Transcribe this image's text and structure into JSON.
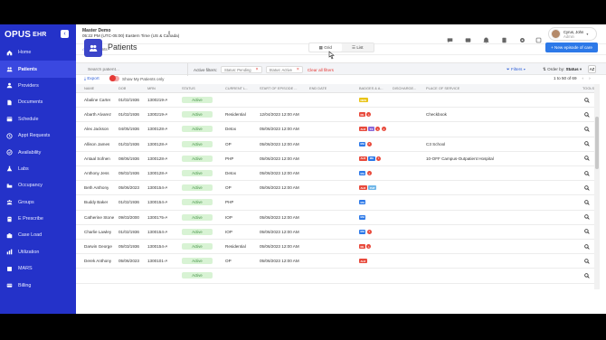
{
  "app": {
    "brand": "OPUS",
    "brand_suffix": "EHR"
  },
  "sidebar": {
    "items": [
      {
        "label": "Home",
        "icon": "home-icon"
      },
      {
        "label": "Patients",
        "icon": "patients-icon",
        "active": true
      },
      {
        "label": "Providers",
        "icon": "providers-icon"
      },
      {
        "label": "Documents",
        "icon": "documents-icon"
      },
      {
        "label": "Schedule",
        "icon": "schedule-icon"
      },
      {
        "label": "Appt Requests",
        "icon": "appt-requests-icon"
      },
      {
        "label": "Availability",
        "icon": "availability-icon"
      },
      {
        "label": "Labs",
        "icon": "labs-icon"
      },
      {
        "label": "Occupancy",
        "icon": "occupancy-icon"
      },
      {
        "label": "Groups",
        "icon": "groups-icon"
      },
      {
        "label": "E Prescribe",
        "icon": "eprescribe-icon"
      },
      {
        "label": "Case Load",
        "icon": "caseload-icon"
      },
      {
        "label": "Utilization",
        "icon": "utilization-icon"
      },
      {
        "label": "MARS",
        "icon": "mars-icon"
      },
      {
        "label": "Billing",
        "icon": "billing-icon"
      }
    ]
  },
  "topbar": {
    "org_name": "Master Demo",
    "org_time": "05:22 PM (UTC-05:00) Eastern Time (US & Canada)",
    "user_name": "Cyrus, John",
    "user_role": "Admin"
  },
  "breadcrumb": {
    "current": "All Patients"
  },
  "header": {
    "title": "Patients",
    "view_grid": "Grid",
    "view_list": "List",
    "new_episode": "+ New episode of care"
  },
  "filters": {
    "search_placeholder": "Search patient...",
    "active_label": "Active filters:",
    "chips": [
      "Status: Pending",
      "Status: Active"
    ],
    "clear_all": "Clear all filters",
    "filters_label": "Filters",
    "order_label": "Order by:",
    "order_value": "Status",
    "sort_dir": "AZ"
  },
  "toolbar": {
    "export": "Export",
    "show_mine": "Show My Patients only",
    "pager": "1 to 50 of 69"
  },
  "table": {
    "columns": [
      "NAME",
      "DOB",
      "MRN",
      "STATUS",
      "CURRENT L...",
      "START OF EPISODE ...",
      "END DATE",
      "BADGES & A...",
      "DISCHARGE...",
      "PLACE OF SERVICE",
      "TOOLS"
    ],
    "rows": [
      {
        "name": "Abaline Carter",
        "dob": "01/02/1936",
        "mrn": "1300219-A",
        "status": "Active",
        "level": "",
        "start": "",
        "place": "",
        "badges": [
          {
            "t": "badge",
            "c": "#e9c417",
            "l": "NEW"
          }
        ]
      },
      {
        "name": "Abarth Alvarez",
        "dob": "01/02/1936",
        "mrn": "1300219-A",
        "status": "Active",
        "level": "Residential",
        "start": "12/04/2023 12:00 AM",
        "place": "Checkbook",
        "badges": [
          {
            "t": "badge",
            "c": "#e84a3c",
            "l": "RE"
          },
          {
            "t": "dot",
            "c": "#e84a3c",
            "l": "1"
          }
        ]
      },
      {
        "name": "Alex Jackson",
        "dob": "04/05/1936",
        "mrn": "1300128-A",
        "status": "Active",
        "level": "Detox",
        "start": "05/06/2023 12:00 AM",
        "place": "",
        "badges": [
          {
            "t": "badge",
            "c": "#e84a3c",
            "l": "ALR"
          },
          {
            "t": "badge",
            "c": "#8a6ad9",
            "l": "TX"
          },
          {
            "t": "dot",
            "c": "#e84a3c",
            "l": "1"
          },
          {
            "t": "dot",
            "c": "#e84a3c",
            "l": "2"
          }
        ]
      },
      {
        "name": "Allison James",
        "dob": "01/02/1936",
        "mrn": "1300128-A",
        "status": "Active",
        "level": "OP",
        "start": "05/06/2023 12:00 AM",
        "place": "C3 School",
        "badges": [
          {
            "t": "badge",
            "c": "#2d79e8",
            "l": "MH"
          },
          {
            "t": "dot",
            "c": "#e84a3c",
            "l": "2"
          }
        ]
      },
      {
        "name": "Antaal Sofnen",
        "dob": "08/06/1936",
        "mrn": "1300128-A",
        "status": "Active",
        "level": "PHP",
        "start": "05/06/2023 12:00 AM",
        "place": "10-OFF Campus-Outpatient Hospital",
        "badges": [
          {
            "t": "badge",
            "c": "#e84a3c",
            "l": "ALR"
          },
          {
            "t": "badge",
            "c": "#2d79e8",
            "l": "MH"
          },
          {
            "t": "dot",
            "c": "#e84a3c",
            "l": "1"
          }
        ]
      },
      {
        "name": "Anthony Jess",
        "dob": "05/02/1936",
        "mrn": "1300128-A",
        "status": "Active",
        "level": "Detox",
        "start": "05/06/2023 12:00 AM",
        "place": "",
        "badges": [
          {
            "t": "badge",
            "c": "#2d79e8",
            "l": "MH"
          },
          {
            "t": "dot",
            "c": "#e84a3c",
            "l": "1"
          }
        ]
      },
      {
        "name": "Beth Anthony",
        "dob": "05/06/2023",
        "mrn": "1300154-A",
        "status": "Active",
        "level": "OP",
        "start": "05/06/2023 12:00 AM",
        "place": "",
        "badges": [
          {
            "t": "badge",
            "c": "#e84a3c",
            "l": "ALR"
          },
          {
            "t": "badge",
            "c": "#6fb6e8",
            "l": "PHP"
          }
        ]
      },
      {
        "name": "Buddy Baker",
        "dob": "01/02/1936",
        "mrn": "1300154-A",
        "status": "Active",
        "level": "PHP",
        "start": "",
        "place": "",
        "badges": [
          {
            "t": "badge",
            "c": "#2d79e8",
            "l": "MH"
          }
        ]
      },
      {
        "name": "Catherine Stone",
        "dob": "09/03/2000",
        "mrn": "13001?5-A",
        "status": "Active",
        "level": "IOP",
        "start": "05/06/2023 12:00 AM",
        "place": "",
        "badges": [
          {
            "t": "badge",
            "c": "#2d79e8",
            "l": "MH"
          }
        ]
      },
      {
        "name": "Charlie Lawley",
        "dob": "01/02/1936",
        "mrn": "1300154-A",
        "status": "Active",
        "level": "IOP",
        "start": "05/06/2023 12:00 AM",
        "place": "",
        "badges": [
          {
            "t": "badge",
            "c": "#2d79e8",
            "l": "MH"
          },
          {
            "t": "dot",
            "c": "#e84a3c",
            "l": "1"
          }
        ]
      },
      {
        "name": "Darwin George",
        "dob": "05/03/1936",
        "mrn": "1300154-A",
        "status": "Active",
        "level": "Residential",
        "start": "05/06/2023 12:00 AM",
        "place": "",
        "badges": [
          {
            "t": "badge",
            "c": "#e84a3c",
            "l": "RE"
          },
          {
            "t": "dot",
            "c": "#e84a3c",
            "l": "1"
          }
        ]
      },
      {
        "name": "Derek Anthony",
        "dob": "05/06/2023",
        "mrn": "1300101-A",
        "status": "Active",
        "level": "OP",
        "start": "05/06/2023 12:00 AM",
        "place": "",
        "badges": [
          {
            "t": "badge",
            "c": "#e84a3c",
            "l": "ALR"
          }
        ]
      },
      {
        "name": "",
        "dob": "",
        "mrn": "",
        "status": "Active",
        "level": "",
        "start": "",
        "place": "",
        "badges": []
      }
    ]
  },
  "colors": {
    "primary": "#2432c9",
    "accent": "#2d79e8",
    "danger": "#e53935",
    "success_bg": "#d8f3d4"
  }
}
